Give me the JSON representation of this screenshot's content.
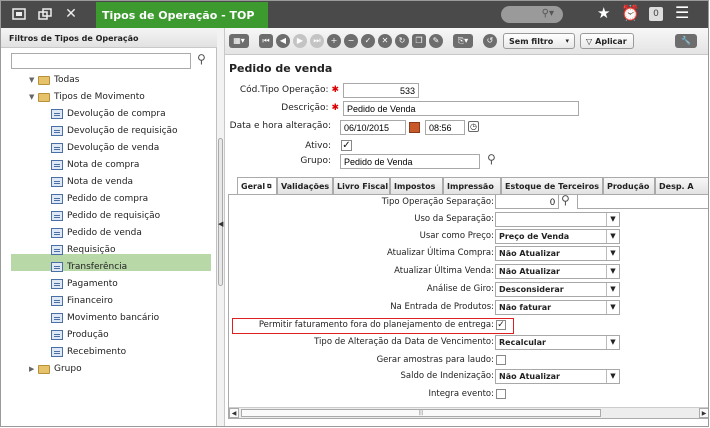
{
  "window": {
    "tab_title": "Tipos de Operação - TOP",
    "notification_count": "0"
  },
  "left_panel": {
    "title": "Filtros de Tipos de Operação",
    "search_value": "",
    "tree": {
      "root": "Todas",
      "group_movimento": "Tipos de Movimento",
      "items": [
        "Devolução de compra",
        "Devolução de requisição",
        "Devolução de venda",
        "Nota de compra",
        "Nota de venda",
        "Pedido de compra",
        "Pedido de requisição",
        "Pedido de venda",
        "Requisição",
        "Transferência",
        "Pagamento",
        "Financeiro",
        "Movimento bancário",
        "Produção",
        "Recebimento"
      ],
      "selected_item": "Pedido de venda",
      "group_grupo": "Grupo"
    }
  },
  "toolbar": {
    "filter_label": "Sem filtro",
    "apply_label": "Aplicar"
  },
  "form": {
    "title": "Pedido de venda",
    "cod_label": "Cód.Tipo Operação:",
    "cod_value": "533",
    "descricao_label": "Descrição:",
    "descricao_value": "Pedido de Venda",
    "data_label": "Data e hora alteração:",
    "data_value": "06/10/2015",
    "hora_value": "08:56",
    "ativo_label": "Ativo:",
    "ativo_checked": true,
    "grupo_label": "Grupo:",
    "grupo_value": "Pedido de Venda"
  },
  "tabs": [
    "Geral",
    "Validações",
    "Livro Fiscal",
    "Impostos",
    "Impressão",
    "Estoque de Terceiros",
    "Produção",
    "Desp. A"
  ],
  "active_tab": "Geral",
  "fields": {
    "tipo_sep_label": "Tipo Operação Separação:",
    "tipo_sep_value": "0",
    "uso_sep_label": "Uso da Separação:",
    "uso_sep_value": "",
    "usar_preco_label": "Usar como Preço:",
    "usar_preco_value": "Preço de Venda",
    "atual_compra_label": "Atualizar Última Compra:",
    "atual_compra_value": "Não Atualizar",
    "atual_venda_label": "Atualizar Última Venda:",
    "atual_venda_value": "Não Atualizar",
    "analise_giro_label": "Análise de Giro:",
    "analise_giro_value": "Desconsiderar",
    "entrada_prod_label": "Na Entrada de Produtos:",
    "entrada_prod_value": "Não faturar",
    "permitir_label": "Permitir faturamento fora do planejamento de entrega:",
    "permitir_checked": true,
    "tipo_alt_label": "Tipo de Alteração da Data de Vencimento:",
    "tipo_alt_value": "Recalcular",
    "gerar_amostras_label": "Gerar amostras para laudo:",
    "gerar_amostras_checked": false,
    "saldo_label": "Saldo de Indenização:",
    "saldo_value": "Não Atualizar",
    "integra_label": "Integra evento:",
    "integra_checked": false
  }
}
